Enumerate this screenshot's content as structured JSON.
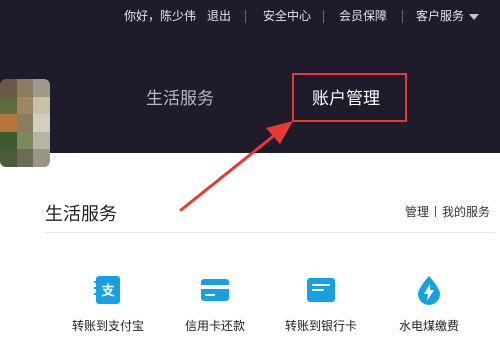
{
  "topbar": {
    "greeting": "你好，陈少伟",
    "logout": "退出",
    "security_center": "安全中心",
    "member_protection": "会员保障",
    "customer_service": "客户服务"
  },
  "hero": {
    "tabs": [
      {
        "label": "生活服务",
        "active": false
      },
      {
        "label": "账户管理",
        "active": true
      }
    ]
  },
  "section": {
    "title": "生活服务",
    "manage_link": "管理",
    "my_services_link": "我的服务"
  },
  "services": [
    {
      "label": "转账到支付宝",
      "icon": "alipay-transfer-icon"
    },
    {
      "label": "信用卡还款",
      "icon": "credit-card-icon"
    },
    {
      "label": "转账到银行卡",
      "icon": "bank-card-icon"
    },
    {
      "label": "水电煤缴费",
      "icon": "utility-drop-icon"
    }
  ],
  "colors": {
    "dark_header": "#1f1b2b",
    "icon_blue": "#1aa0e0",
    "annotation_red": "#e53935"
  }
}
